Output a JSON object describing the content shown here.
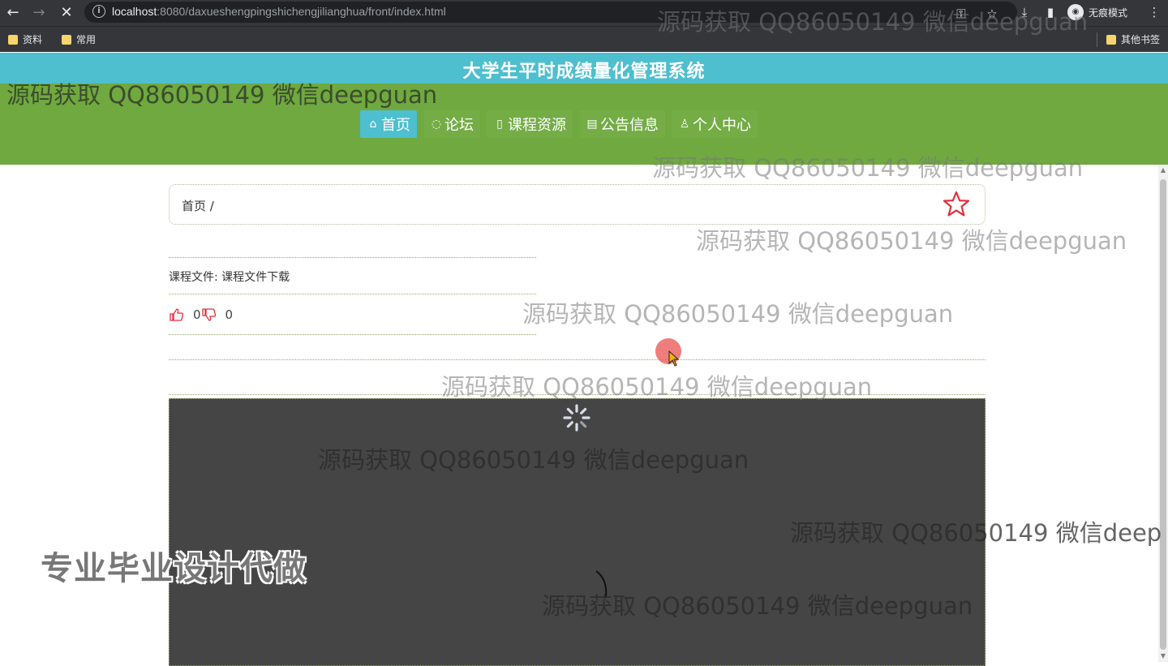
{
  "browser": {
    "url_host": "localhost",
    "url_rest": ":8080/daxueshengpingshichengjilianghua/front/index.html",
    "profile_label": "无痕模式",
    "bookmarks": [
      "资料",
      "常用"
    ],
    "other_bookmarks": "其他书签"
  },
  "site": {
    "title": "大学生平时成绩量化管理系统",
    "menu": [
      {
        "icon": "⌂",
        "label": "首页"
      },
      {
        "icon": "◌",
        "label": "论坛"
      },
      {
        "icon": "▯",
        "label": "课程资源"
      },
      {
        "icon": "▤",
        "label": "公告信息"
      },
      {
        "icon": "♙",
        "label": "个人中心"
      }
    ]
  },
  "breadcrumb": {
    "text": "首页 /"
  },
  "content": {
    "course_file": "课程文件: 课程文件下载",
    "likes": "0",
    "dislikes": "0"
  },
  "watermarks": {
    "text": "源码获取 QQ86050149 微信deepguan",
    "text_cut": "源码获取 QQ86050149 微信deep",
    "banner": "专业毕业设计代做"
  },
  "colors": {
    "title_bar": "#4dbfcf",
    "nav_bar": "#6fa93f",
    "active_menu": "#4dbfcf",
    "video_bg": "#454545"
  }
}
